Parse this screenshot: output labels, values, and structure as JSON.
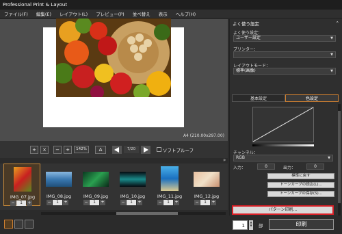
{
  "window": {
    "title": "Professional Print & Layout"
  },
  "menu": [
    "ファイル(F)",
    "編集(E)",
    "レイアウト(L)",
    "プレビュー(P)",
    "並べ替え",
    "表示",
    "ヘルプ(H)"
  ],
  "preview": {
    "paper_size_label": "A4 (210.00x297.00)"
  },
  "toolbar": {
    "zoom": "142%",
    "page": "7/20",
    "softproof_label": "ソフトプルーフ"
  },
  "thumbnails": [
    {
      "name": "IMG_07.jpg",
      "count": "1",
      "selected": true
    },
    {
      "name": "IMG_08.jpg",
      "count": "1",
      "selected": false
    },
    {
      "name": "IMG_09.jpg",
      "count": "1",
      "selected": false
    },
    {
      "name": "IMG_10.jpg",
      "count": "1",
      "selected": false
    },
    {
      "name": "IMG_11.jpg",
      "count": "1",
      "selected": false
    },
    {
      "name": "IMG_12.jpg",
      "count": "1",
      "selected": false
    }
  ],
  "panel": {
    "title": "よく使う設定",
    "favorite_label": "よく使う設定：",
    "favorite_value": "ユーザー設定",
    "printer_label": "プリンター：",
    "printer_value": "",
    "layout_mode_label": "レイアウトモード：",
    "layout_mode_value": "標準(画像)",
    "tab_basic": "基本設定",
    "tab_color": "色設定",
    "channel_label": "チャンネル：",
    "channel_value": "RGB",
    "input_label": "入力：",
    "input_value": "0",
    "output_label": "出力：",
    "output_value": "0",
    "reset_button": "標準に戻す",
    "load_curve_button": "トーンカーブの読込(L)...",
    "save_curve_button": "トーンカーブの保存(S)...",
    "pattern_print_button": "パターン印刷..."
  },
  "print": {
    "copies": "1",
    "copies_unit": "部",
    "print_button": "印刷"
  }
}
